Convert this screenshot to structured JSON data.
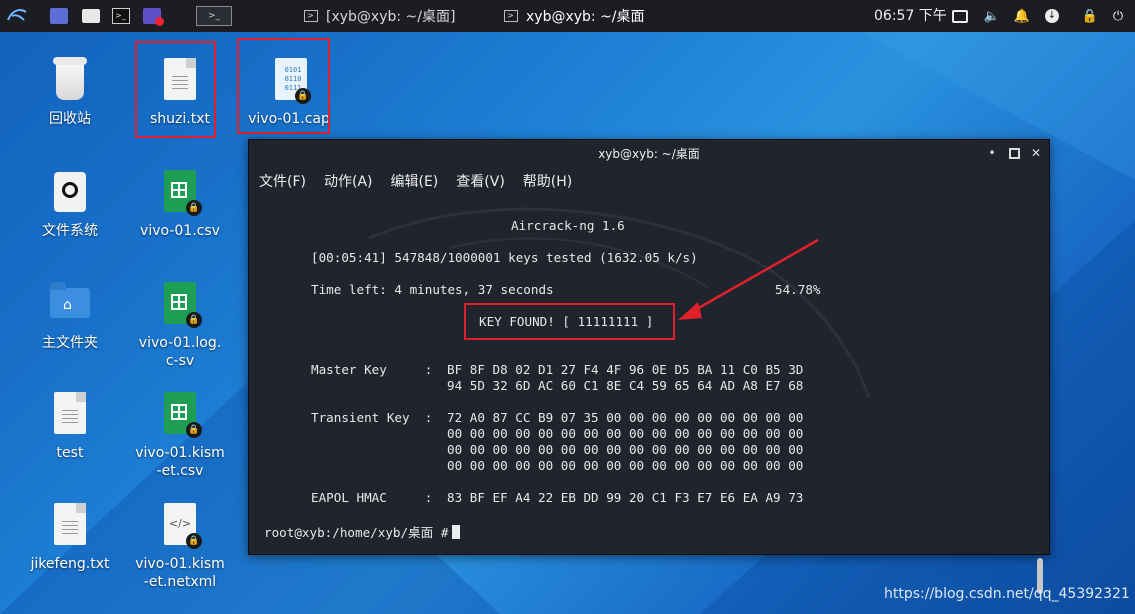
{
  "panel": {
    "tasks": [
      {
        "label": "[xyb@xyb: ~/桌面]"
      },
      {
        "label": "xyb@xyb: ~/桌面"
      }
    ],
    "clock": "06:57 下午"
  },
  "desktop": {
    "icons": [
      {
        "name": "trash",
        "label": "回收站"
      },
      {
        "name": "file-system",
        "label": "文件系统"
      },
      {
        "name": "home-folder",
        "label": "主文件夹"
      },
      {
        "name": "test",
        "label": "test"
      },
      {
        "name": "jikefeng",
        "label": "jikefeng.txt"
      },
      {
        "name": "shuzi",
        "label": "shuzi.txt"
      },
      {
        "name": "vivo-csv",
        "label": "vivo-01.csv"
      },
      {
        "name": "vivo-log",
        "label": "vivo-01.log.c-sv"
      },
      {
        "name": "vivo-kismet-csv",
        "label": "vivo-01.kism-et.csv"
      },
      {
        "name": "vivo-kismet-netxml",
        "label": "vivo-01.kism-et.netxml"
      },
      {
        "name": "vivo-cap",
        "label": "vivo-01.cap"
      }
    ]
  },
  "terminal": {
    "title": "xyb@xyb: ~/桌面",
    "menu": [
      "文件(F)",
      "动作(A)",
      "编辑(E)",
      "查看(V)",
      "帮助(H)"
    ],
    "lines": {
      "header": "Aircrack-ng 1.6",
      "progress": "[00:05:41] 547848/1000001 keys tested (1632.05 k/s)",
      "time_left": "Time left: 4 minutes, 37 seconds",
      "percent": "54.78%",
      "key_found": "KEY FOUND! [ 11111111 ]",
      "master_label": "Master Key     :",
      "master_1": "BF 8F D8 02 D1 27 F4 4F 96 0E D5 BA 11 C0 B5 3D",
      "master_2": "94 5D 32 6D AC 60 C1 8E C4 59 65 64 AD A8 E7 68",
      "transient_label": "Transient Key  :",
      "transient_1": "72 A0 87 CC B9 07 35 00 00 00 00 00 00 00 00 00",
      "transient_2": "00 00 00 00 00 00 00 00 00 00 00 00 00 00 00 00",
      "transient_3": "00 00 00 00 00 00 00 00 00 00 00 00 00 00 00 00",
      "transient_4": "00 00 00 00 00 00 00 00 00 00 00 00 00 00 00 00",
      "eapol_label": "EAPOL HMAC     :",
      "eapol_1": "83 BF EF A4 22 EB DD 99 20 C1 F3 E7 E6 EA A9 73",
      "prompt": "root@xyb:/home/xyb/桌面 #"
    }
  },
  "watermark": "https://blog.csdn.net/qq_45392321",
  "colors": {
    "highlight": "#e0202a",
    "panel": "#1b1d22",
    "terminal_bg": "#20242c"
  }
}
